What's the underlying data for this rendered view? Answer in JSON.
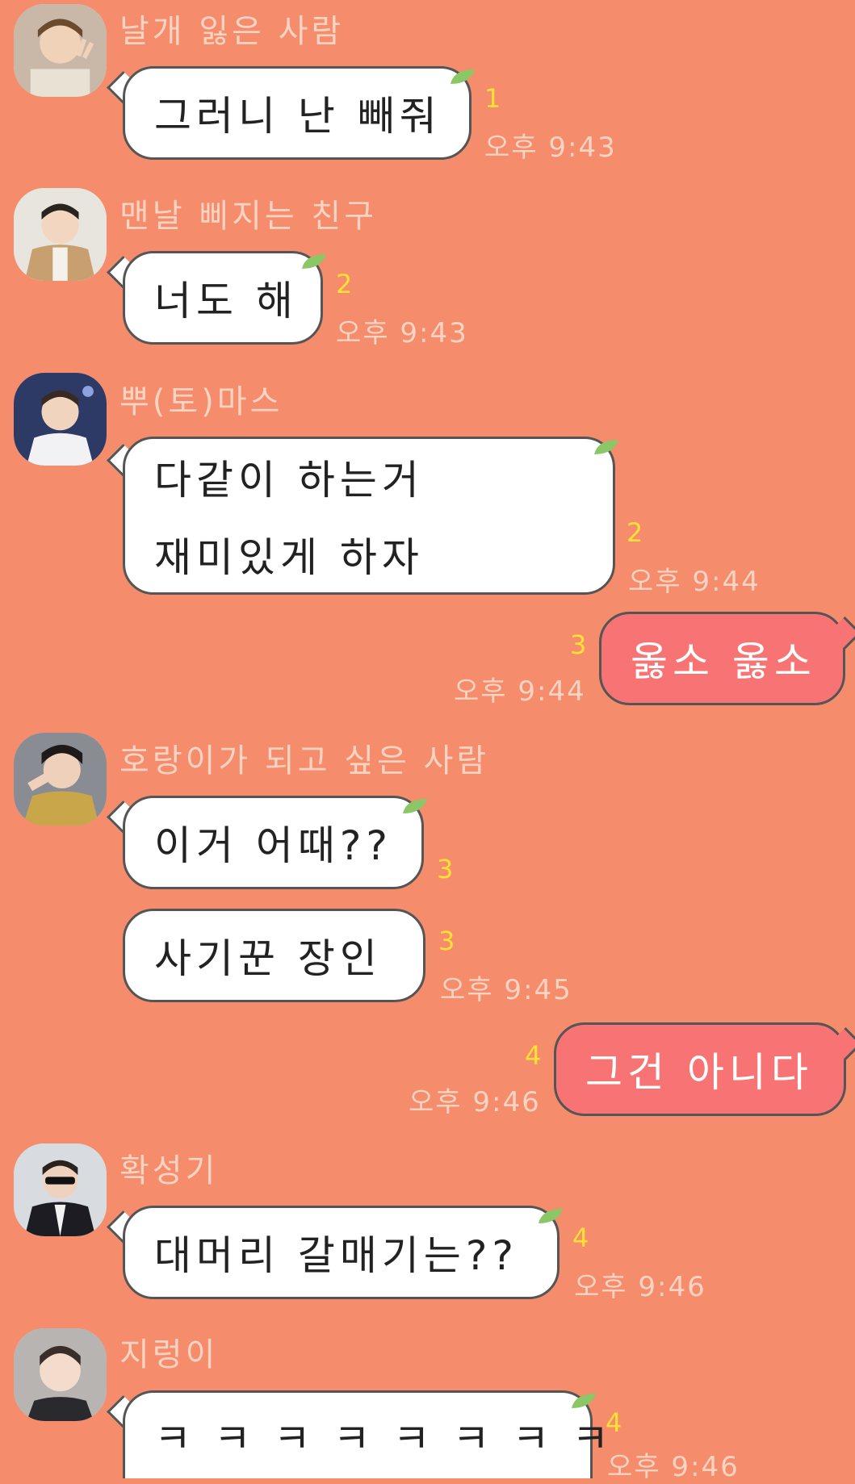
{
  "messages": [
    {
      "sender": "날개 잃은 사람",
      "text": "그러니 난 빼줘",
      "read": "1",
      "time": "오후 9:43"
    },
    {
      "sender": "맨날 삐지는 친구",
      "text": "너도 해",
      "read": "2",
      "time": "오후 9:43"
    },
    {
      "sender": "뿌(토)마스",
      "line1": "다같이 하는거",
      "line2": "재미있게 하자",
      "read": "2",
      "time": "오후 9:44"
    },
    {
      "text": "옳소 옳소",
      "read": "3",
      "time": "오후 9:44"
    },
    {
      "sender": "호랑이가 되고 싶은 사람",
      "text": "이거 어때??",
      "read": "3"
    },
    {
      "text": "사기꾼 장인",
      "read": "3",
      "time": "오후 9:45"
    },
    {
      "text": "그건 아니다",
      "read": "4",
      "time": "오후 9:46"
    },
    {
      "sender": "확성기",
      "text": "대머리 갈매기는??",
      "read": "4",
      "time": "오후 9:46"
    },
    {
      "sender": "지렁이",
      "text": "ㅋ ㅋ ㅋ ㅋ ㅋ ㅋ ㅋ ㅋ",
      "read": "4",
      "time": "오후 9:46"
    }
  ],
  "colors": {
    "background": "#F58C6B",
    "bubble_other": "#FFFFFF",
    "bubble_mine": "#F87474",
    "name_text": "#FBD3C2",
    "read_count": "#FFE135",
    "leaf": "#8BC766"
  }
}
